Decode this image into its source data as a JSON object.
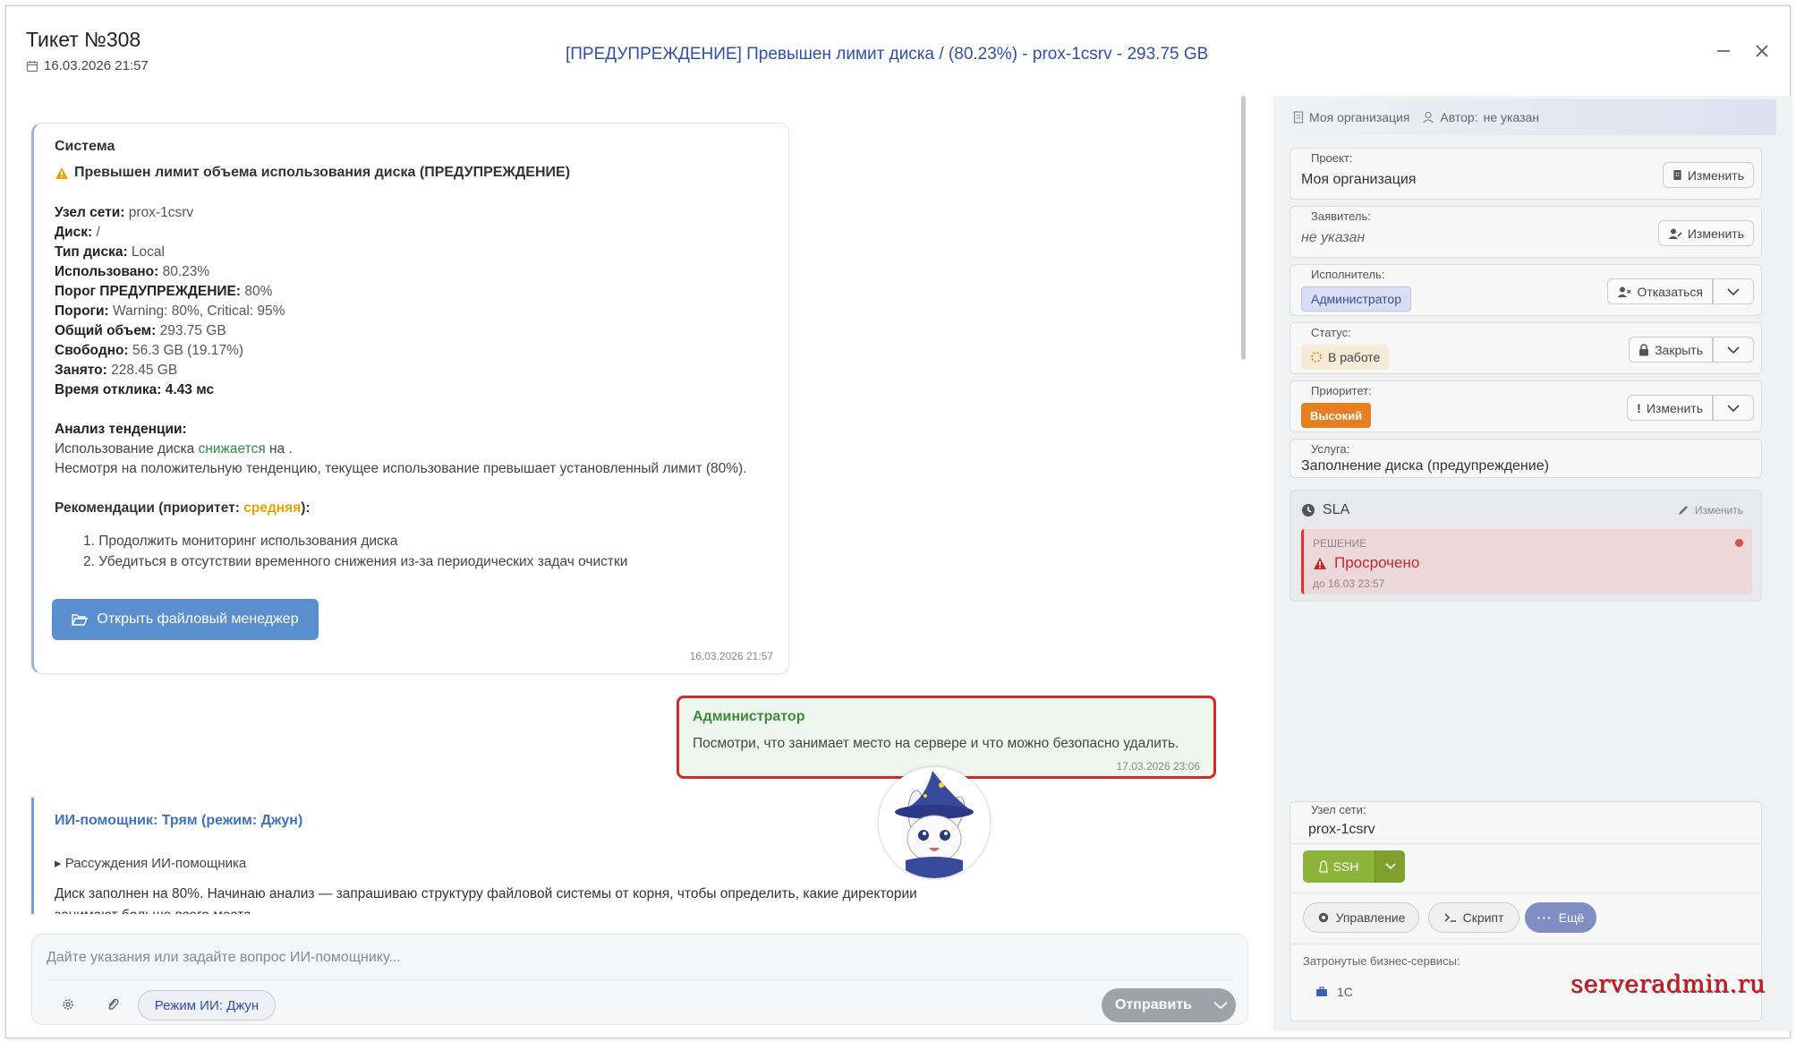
{
  "header": {
    "title": "Тикет №308",
    "date": "16.03.2026 21:57",
    "subject": "[ПРЕДУПРЕЖДЕНИЕ] Превышен лимит диска / (80.23%) - prox-1csrv - 293.75 GB"
  },
  "system_message": {
    "author": "Система",
    "heading": "Превышен лимит объема использования диска (ПРЕДУПРЕЖДЕНИЕ)",
    "fields": [
      {
        "k": "Узел сети:",
        "v": "prox-1csrv"
      },
      {
        "k": "Диск:",
        "v": "/"
      },
      {
        "k": "Тип диска:",
        "v": "Local"
      },
      {
        "k": "Использовано:",
        "v": "80.23%"
      },
      {
        "k": "Порог ПРЕДУПРЕЖДЕНИЕ:",
        "v": "80%"
      },
      {
        "k": "Пороги:",
        "v": "Warning: 80%, Critical: 95%"
      },
      {
        "k": "Общий объем:",
        "v": "293.75 GB"
      },
      {
        "k": "Свободно:",
        "v": "56.3 GB (19.17%)"
      },
      {
        "k": "Занято:",
        "v": "228.45 GB"
      },
      {
        "k": "Время отклика:",
        "v": "4.43 мс"
      }
    ],
    "analysis_title": "Анализ тенденции:",
    "analysis_pre": "Использование диска",
    "analysis_trend": "снижается",
    "analysis_post": "на .",
    "analysis_note": "Несмотря на положительную тенденцию, текущее использование превышает установленный лимит (80%).",
    "rec_title_pre": "Рекомендации (приоритет:",
    "rec_priority": "средняя",
    "rec_title_post": "):",
    "recommendations": [
      "1. Продолжить мониторинг использования диска",
      "2. Убедиться в отсутствии временного снижения из-за периодических задач очистки"
    ],
    "button": "Открыть файловый менеджер",
    "time": "16.03.2026 21:57"
  },
  "admin_message": {
    "author": "Администратор",
    "text": "Посмотри, что занимает место на сервере и что можно безопасно удалить.",
    "time": "17.03.2026 23:06"
  },
  "ai_message": {
    "author": "ИИ-помощник: Трям (режим: Джун)",
    "thinking": "▸ Рассуждения ИИ-помощника",
    "text": "Диск заполнен на 80%. Начинаю анализ — запрашиваю структуру файловой системы от корня, чтобы определить, какие директории занимают больше всего места"
  },
  "composer": {
    "placeholder": "Дайте указания или задайте вопрос ИИ-помощнику...",
    "mode": "Режим ИИ: Джун",
    "send": "Отправить"
  },
  "sidebar": {
    "org": "Моя организация",
    "author_label": "Автор:",
    "author_value": "не указан",
    "project_label": "Проект:",
    "project_value": "Моя организация",
    "change": "Изменить",
    "requester_label": "Заявитель:",
    "requester_value": "не указан",
    "assignee_label": "Исполнитель:",
    "assignee_value": "Администратор",
    "refuse": "Отказаться",
    "status_label": "Статус:",
    "status_value": "В работе",
    "close": "Закрыть",
    "priority_label": "Приоритет:",
    "priority_value": "Высокий",
    "service_label": "Услуга:",
    "service_value": "Заполнение диска (предупреждение)",
    "sla_title": "SLA",
    "sla_change": "Изменить",
    "sla_kind": "РЕШЕНИЕ",
    "sla_state": "Просрочено",
    "sla_deadline": "до 16.03 23:57",
    "node_label": "Узел сети:",
    "node_value": "prox-1csrv",
    "ssh": "SSH",
    "manage": "Управление",
    "script": "Скрипт",
    "more": "Ещё",
    "biz_label": "Затронутые бизнес-сервисы:",
    "biz_value": "1С"
  },
  "watermark": "serveradmin.ru",
  "colors": {
    "accent": "#2f4fa8",
    "danger": "#d42a2a",
    "ssh": "#8cb33a",
    "priority": "#e67e22"
  }
}
